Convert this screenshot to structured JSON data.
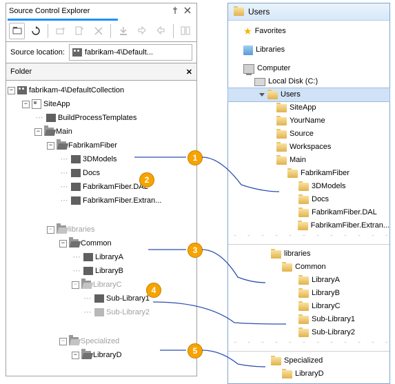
{
  "left": {
    "title": "Source Control Explorer",
    "location_label": "Source location:",
    "location_value": "fabrikam-4\\Default...",
    "folder_header": "Folder",
    "tree": {
      "root": "fabrikam-4\\DefaultCollection",
      "siteapp": "SiteApp",
      "build": "BuildProcessTemplates",
      "main": "Main",
      "ff": "FabrikamFiber",
      "models": "3DModels",
      "docs": "Docs",
      "dal": "FabrikamFiber.DAL",
      "extran": "FabrikamFiber.Extran...",
      "libraries": "libraries",
      "common": "Common",
      "la": "LibraryA",
      "lb": "LibraryB",
      "lc": "LibraryC",
      "sub1": "Sub-Library1",
      "sub2": "Sub-Library2",
      "specialized": "Specialized",
      "ld": "LibraryD"
    }
  },
  "right": {
    "title": "Users",
    "fav": "Favorites",
    "lib": "Libraries",
    "comp": "Computer",
    "disk": "Local Disk (C:)",
    "users": "Users",
    "siteapp": "SiteApp",
    "yourname": "YourName",
    "source": "Source",
    "workspaces": "Workspaces",
    "main": "Main",
    "ff": "FabrikamFiber",
    "models": "3DModels",
    "docs": "Docs",
    "dal": "FabrikamFiber.DAL",
    "extran": "FabrikamFiber.Extran...",
    "libraries": "libraries",
    "common": "Common",
    "la": "LibraryA",
    "lb": "LibraryB",
    "lc": "LibraryC",
    "sub1": "Sub-Library1",
    "sub2": "Sub-Library2",
    "specialized": "Specialized",
    "ld": "LibraryD"
  },
  "callouts": {
    "c1": "1",
    "c2": "2",
    "c3": "3",
    "c4": "4",
    "c5": "5"
  }
}
